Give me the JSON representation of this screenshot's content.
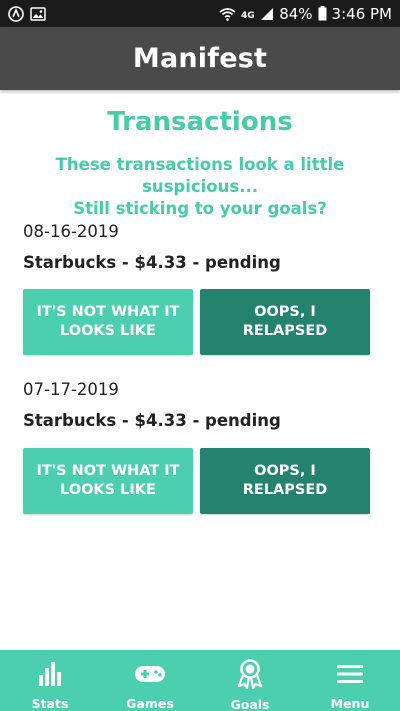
{
  "status_bar": {
    "battery": "84%",
    "time": "3:46 PM",
    "icons": [
      "app-notification-icon",
      "image-notification-icon",
      "wifi-icon",
      "network-type-icon",
      "signal-icon",
      "battery-icon"
    ]
  },
  "app_bar": {
    "title": "Manifest"
  },
  "main": {
    "title": "Transactions",
    "subtitle_line1": "These transactions look a little suspicious...",
    "subtitle_line2": "Still sticking to your goals?",
    "transactions": [
      {
        "date": "08-16-2019",
        "description": "Starbucks - $4.33 - pending",
        "not_what_it_looks_label": "IT'S NOT WHAT IT LOOKS LIKE",
        "relapsed_label": "OOPS, I RELAPSED"
      },
      {
        "date": "07-17-2019",
        "description": "Starbucks - $4.33 - pending",
        "not_what_it_looks_label": "IT'S NOT WHAT IT LOOKS LIKE",
        "relapsed_label": "OOPS, I RELAPSED"
      }
    ]
  },
  "bottom_nav": {
    "items": [
      {
        "label": "Stats",
        "icon": "bar-chart-icon"
      },
      {
        "label": "Games",
        "icon": "gamepad-icon"
      },
      {
        "label": "Goals",
        "icon": "award-ribbon-icon"
      },
      {
        "label": "Menu",
        "icon": "hamburger-menu-icon"
      }
    ]
  },
  "colors": {
    "accent": "#45cca8",
    "button_light": "#4ccfae",
    "button_dark": "#23836d",
    "app_bar": "#4a4a4a",
    "status_bar": "#1b1b1b"
  }
}
